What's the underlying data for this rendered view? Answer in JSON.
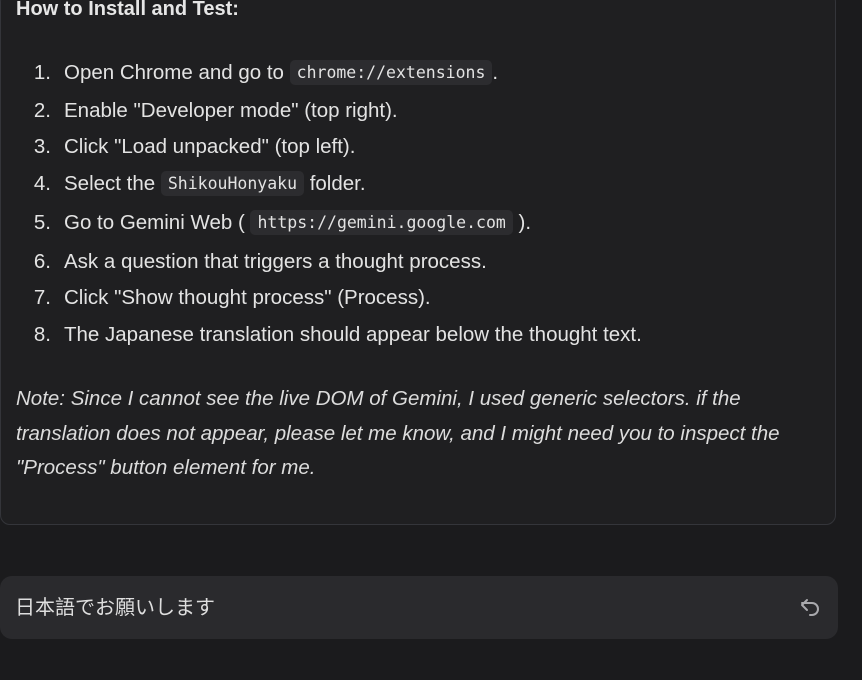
{
  "message": {
    "heading": "How to Install and Test:",
    "steps": [
      {
        "num": "1.",
        "before": "Open Chrome and go to ",
        "code": "chrome://extensions",
        "after": "."
      },
      {
        "num": "2.",
        "before": "Enable \"Developer mode\" (top right).",
        "code": "",
        "after": ""
      },
      {
        "num": "3.",
        "before": "Click \"Load unpacked\" (top left).",
        "code": "",
        "after": ""
      },
      {
        "num": "4.",
        "before": "Select the ",
        "code": "ShikouHonyaku",
        "after": " folder."
      },
      {
        "num": "5.",
        "before": "Go to Gemini Web ( ",
        "code": "https://gemini.google.com",
        "after": " )."
      },
      {
        "num": "6.",
        "before": "Ask a question that triggers a thought process.",
        "code": "",
        "after": ""
      },
      {
        "num": "7.",
        "before": "Click \"Show thought process\" (Process).",
        "code": "",
        "after": ""
      },
      {
        "num": "8.",
        "before": "The Japanese translation should appear below the thought text.",
        "code": "",
        "after": ""
      }
    ],
    "note": "Note: Since I cannot see the live DOM of Gemini, I used generic selectors. if the translation does not appear, please let me know, and I might need you to inspect the \"Process\" button element for me."
  },
  "prompt_bar": {
    "text": "日本語でお願いします",
    "undo_icon": "undo-icon"
  },
  "colors": {
    "background": "#1b1b1d",
    "card": "#1f1f21",
    "code_bg": "#2c2c2f",
    "input_bg": "#2a2a2d",
    "text": "#e3e3e3"
  }
}
